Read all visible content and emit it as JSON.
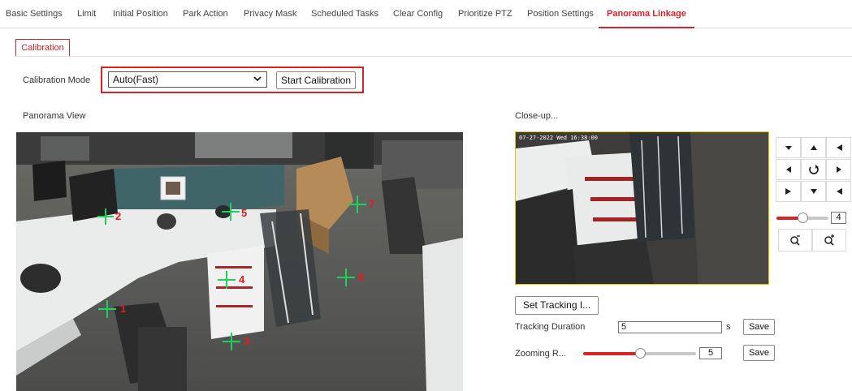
{
  "tabs": [
    {
      "label": "Basic Settings"
    },
    {
      "label": "Limit"
    },
    {
      "label": "Initial Position"
    },
    {
      "label": "Park Action"
    },
    {
      "label": "Privacy Mask"
    },
    {
      "label": "Scheduled Tasks"
    },
    {
      "label": "Clear Config"
    },
    {
      "label": "Prioritize PTZ"
    },
    {
      "label": "Position Settings"
    },
    {
      "label": "Panorama Linkage",
      "active": true
    }
  ],
  "subtab": "Calibration",
  "calibration": {
    "mode_label": "Calibration Mode",
    "mode_value": "Auto(Fast)",
    "start_button": "Start Calibration"
  },
  "panorama": {
    "title": "Panorama View",
    "markers": [
      "1",
      "2",
      "3",
      "4",
      "5",
      "6",
      "7"
    ]
  },
  "closeup": {
    "title": "Close-up...",
    "timestamp": "07-27-2022 Wed 16:38:00"
  },
  "ptz": {
    "speed_value": "4",
    "speed_fraction": 0.5,
    "icons": [
      "arrow-up-left-icon",
      "arrow-up-icon",
      "arrow-up-right-icon",
      "arrow-left-icon",
      "auto-rotate-icon",
      "arrow-right-icon",
      "arrow-down-left-icon",
      "arrow-down-icon",
      "arrow-down-right-icon",
      "zoom-out-icon",
      "zoom-in-icon"
    ]
  },
  "tracking": {
    "set_button": "Set Tracking I...",
    "duration_label": "Tracking Duration",
    "duration_value": "5",
    "duration_unit": "s",
    "save_label": "Save",
    "zooming_label": "Zooming R...",
    "zooming_value": "5",
    "zooming_fraction": 0.5
  },
  "colors": {
    "accent": "#d8232a",
    "marker_cross": "#19d35a",
    "marker_text": "#e61c1c",
    "closeup_border": "#e9c500"
  }
}
